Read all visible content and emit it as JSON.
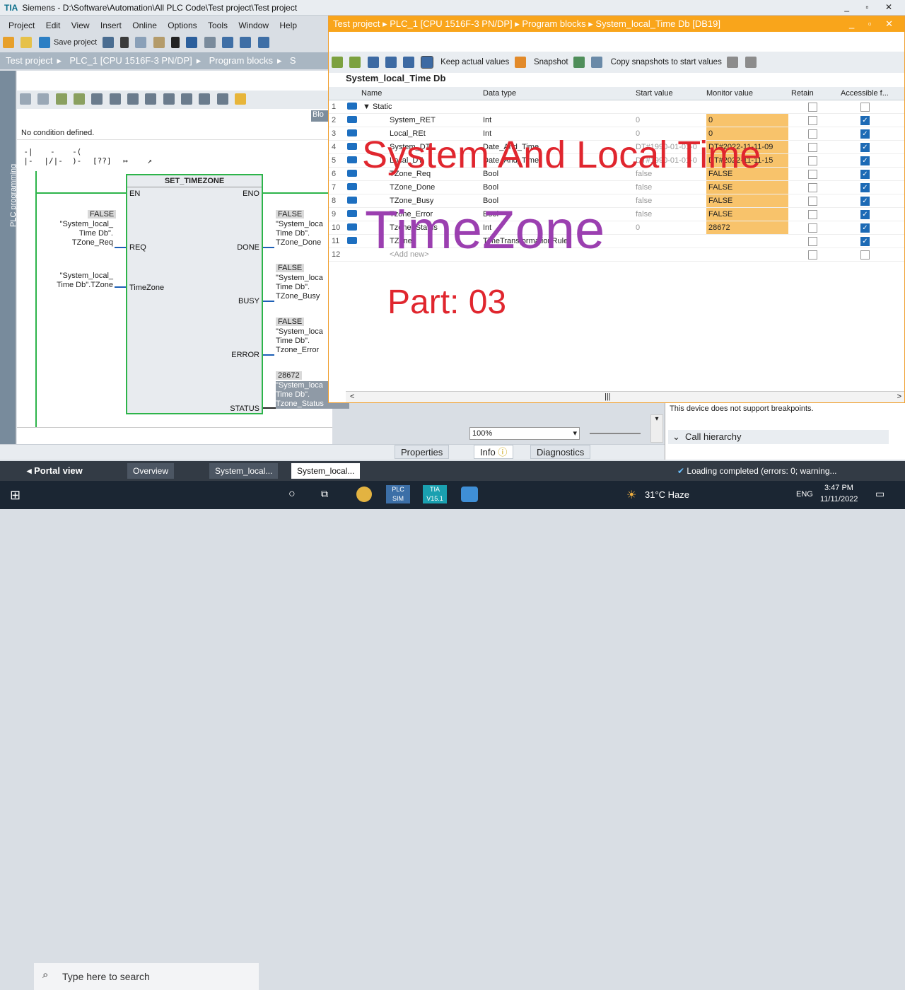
{
  "app": {
    "title": "Siemens  -  D:\\Software\\Automation\\All PLC Code\\Test project\\Test project",
    "logo": "TIA"
  },
  "menu": [
    "Project",
    "Edit",
    "View",
    "Insert",
    "Online",
    "Options",
    "Tools",
    "Window",
    "Help"
  ],
  "toolbar": {
    "save_label": "Save project"
  },
  "breadcrumb": [
    "Test project",
    "PLC_1 [CPU 1516F-3 PN/DP]",
    "Program blocks",
    "S"
  ],
  "sidetab": "PLC programming",
  "editor": {
    "blo_label": "Blo",
    "condition": "No condition defined."
  },
  "block": {
    "name": "SET_TIMEZONE",
    "en": "EN",
    "eno": "ENO",
    "req": "REQ",
    "timezone": "TimeZone",
    "done": "DONE",
    "busy": "BUSY",
    "error": "ERROR",
    "status": "STATUS",
    "in_req_val": "FALSE",
    "in_req_tag": "\"System_local_\nTime Db\".\nTZone_Req",
    "in_tz_tag": "\"System_local_\nTime Db\".TZone",
    "out_done_val": "FALSE",
    "out_done_tag": "\"System_loca\nTime Db\".\nTZone_Done",
    "out_busy_val": "FALSE",
    "out_busy_tag": "\"System_loca\nTime Db\".\nTZone_Busy",
    "out_error_val": "FALSE",
    "out_error_tag": "\"System_loca\nTime Db\".\nTzone_Error",
    "out_status_val": "28672",
    "out_status_tag": "\"System_loca\nTime Db\".\nTzone_Status"
  },
  "db": {
    "path": "Test project  ▸  PLC_1 [CPU 1516F-3 PN/DP]  ▸  Program blocks  ▸  System_local_Time Db [DB19]",
    "tool_keep": "Keep actual values",
    "tool_snapshot": "Snapshot",
    "tool_copy": "Copy snapshots to start values",
    "name": "System_local_Time Db",
    "headers": {
      "name": "Name",
      "type": "Data type",
      "start": "Start value",
      "monitor": "Monitor value",
      "retain": "Retain",
      "access": "Accessible f..."
    },
    "rows": [
      {
        "n": "1",
        "name": "▼  Static",
        "type": "",
        "start": "",
        "mon": ""
      },
      {
        "n": "2",
        "name": "System_RET",
        "type": "Int",
        "start": "0",
        "mon": "0"
      },
      {
        "n": "3",
        "name": "Local_REt",
        "type": "Int",
        "start": "0",
        "mon": "0"
      },
      {
        "n": "4",
        "name": "System_DT",
        "type": "Date_And_Time",
        "start": "DT#1990-01-01-0",
        "mon": "DT#2022-11-11-09"
      },
      {
        "n": "5",
        "name": "Local_DT",
        "type": "Date_And_Time",
        "start": "DT#1990-01-01-0",
        "mon": "DT#2022-11-11-15"
      },
      {
        "n": "6",
        "name": "TZone_Req",
        "type": "Bool",
        "start": "false",
        "mon": "FALSE"
      },
      {
        "n": "7",
        "name": "TZone_Done",
        "type": "Bool",
        "start": "false",
        "mon": "FALSE"
      },
      {
        "n": "8",
        "name": "TZone_Busy",
        "type": "Bool",
        "start": "false",
        "mon": "FALSE"
      },
      {
        "n": "9",
        "name": "Tzone_Error",
        "type": "Bool",
        "start": "false",
        "mon": "FALSE"
      },
      {
        "n": "10",
        "name": "Tzone_Status",
        "type": "Int",
        "start": "0",
        "mon": "28672"
      },
      {
        "n": "11",
        "name": "TZone",
        "type": "TimeTransformationRule",
        "start": "",
        "mon": ""
      },
      {
        "n": "12",
        "name": "<Add new>",
        "type": "",
        "start": "",
        "mon": ""
      }
    ]
  },
  "overlay": {
    "line1": "System And Local Time",
    "line2": "TimeZone",
    "line3": "Part: 03"
  },
  "bottom": {
    "zoom": "100%",
    "properties": "Properties",
    "info": "Info",
    "diagnostics": "Diagnostics",
    "breakpoints": "This device does not support breakpoints.",
    "callhier": "Call hierarchy",
    "loading": "Loading completed (errors: 0; warning..."
  },
  "portal": {
    "view": "Portal view",
    "overview": "Overview",
    "task1": "System_local...",
    "task2": "System_local..."
  },
  "taskbar": {
    "search": "Type here to search",
    "weather": "31°C  Haze",
    "lang": "ENG",
    "time": "3:47 PM",
    "date": "11/11/2022",
    "plcsim": "PLC SIM",
    "tia": "TIA V15.1"
  },
  "colors": {
    "orange": "#f9a51b",
    "green": "#2db44a",
    "overlayRed": "#e0262e",
    "overlayPurple": "#9b3fb0"
  }
}
